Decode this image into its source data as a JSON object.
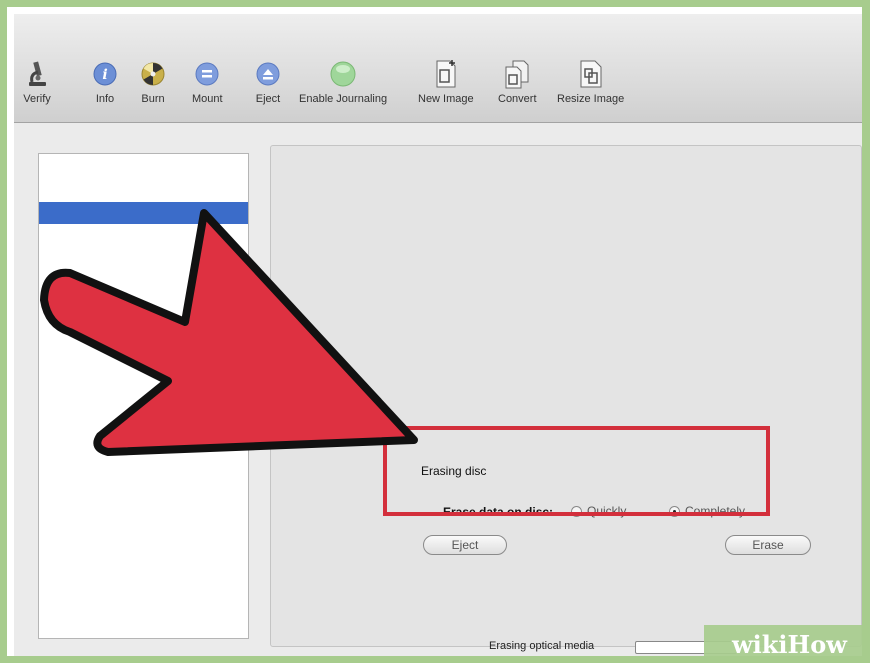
{
  "toolbar": {
    "items": [
      {
        "label": "Verify",
        "icon": "microscope-icon"
      },
      {
        "label": "Info",
        "icon": "info-icon"
      },
      {
        "label": "Burn",
        "icon": "burn-icon"
      },
      {
        "label": "Mount",
        "icon": "mount-icon"
      },
      {
        "label": "Eject",
        "icon": "eject-icon"
      },
      {
        "label": "Enable Journaling",
        "icon": "journaling-icon"
      },
      {
        "label": "New Image",
        "icon": "new-image-icon"
      },
      {
        "label": "Convert",
        "icon": "convert-icon"
      },
      {
        "label": "Resize Image",
        "icon": "resize-image-icon"
      }
    ]
  },
  "erase": {
    "title": "Erasing disc",
    "option_label": "Erase data on disc:",
    "options": [
      {
        "label": "Quickly",
        "selected": false
      },
      {
        "label": "Completely",
        "selected": true
      }
    ],
    "eject_button": "Eject",
    "erase_button": "Erase"
  },
  "status": {
    "text": "Erasing optical media"
  },
  "watermark": {
    "text": "wikiHow"
  },
  "colors": {
    "frame": "#a7cc8d",
    "selection": "#3b6cc9",
    "arrow": "#de3141",
    "highlight": "#d32f3c"
  }
}
